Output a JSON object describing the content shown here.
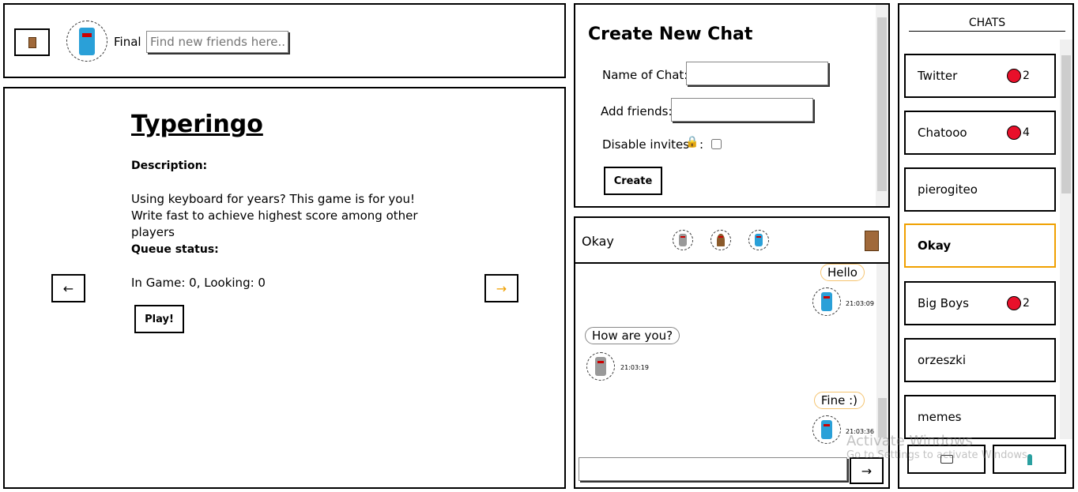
{
  "topbar": {
    "username": "Final",
    "search_placeholder": "Find new friends here...",
    "logout_icon": "door-icon"
  },
  "game": {
    "title": "Typeringo",
    "description_label": "Description:",
    "description": "Using keyboard for years? This game is for you! Write fast to achieve highest score among other players",
    "queue_label": "Queue status:",
    "queue_status": "In Game: 0, Looking: 0",
    "play_label": "Play!",
    "prev_label": "←",
    "next_label": "→"
  },
  "create_chat": {
    "title": "Create New Chat",
    "name_label": "Name of Chat:",
    "friends_label": "Add friends:",
    "disable_invites_label": "Disable invites",
    "lock_icon": "🔒",
    "colon": ":",
    "create_label": "Create"
  },
  "chat": {
    "name": "Okay",
    "send_label": "→",
    "messages": [
      {
        "text": "Hello",
        "time": "21:03:09",
        "own": true
      },
      {
        "text": "How are you?",
        "time": "21:03:19",
        "own": false
      },
      {
        "text": "Fine :)",
        "time": "21:03:36",
        "own": true
      }
    ]
  },
  "sidebar": {
    "title": "CHATS",
    "chats": [
      {
        "name": "Twitter",
        "unread": "2"
      },
      {
        "name": "Chatooo",
        "unread": "4"
      },
      {
        "name": "pierogiteo"
      },
      {
        "name": "Okay",
        "active": true
      },
      {
        "name": "Big Boys",
        "unread": "2"
      },
      {
        "name": "orzeszki"
      },
      {
        "name": "memes"
      }
    ],
    "unread_color": "#e8102a",
    "active_color": "#f0a000"
  },
  "watermark": {
    "line1": "Activate Windows",
    "line2": "Go to Settings to activate Windows."
  }
}
